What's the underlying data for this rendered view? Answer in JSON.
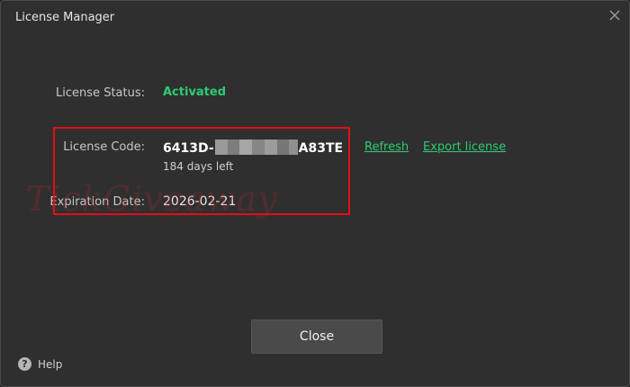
{
  "window": {
    "title": "License Manager",
    "close_icon": "close-icon"
  },
  "license": {
    "status_label": "License Status:",
    "status_value": "Activated",
    "code_label": "License Code:",
    "code_prefix": "6413D-",
    "code_suffix": "A83TE",
    "refresh_label": "Refresh",
    "export_label": "Export license",
    "days_left": "184 days left",
    "expiration_label": "Expiration Date:",
    "expiration_value": "2026-02-21"
  },
  "watermark": {
    "text": "TickGiveaway"
  },
  "footer": {
    "close_label": "Close",
    "help_label": "Help",
    "help_icon": "question-icon"
  },
  "colors": {
    "accent_green": "#2ecc71",
    "highlight_red": "#e0101a",
    "background": "#2f2f2f"
  }
}
